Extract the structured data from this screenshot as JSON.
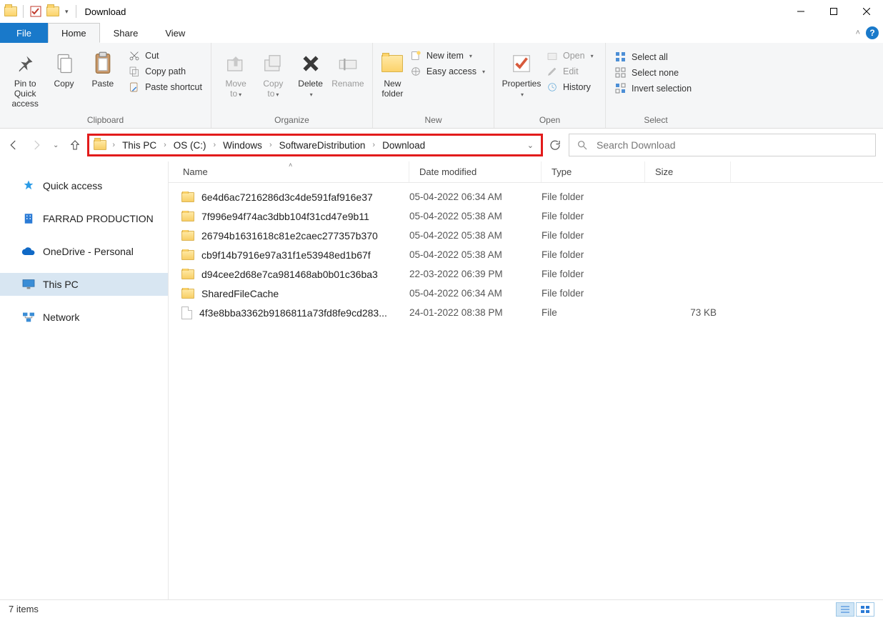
{
  "window": {
    "title": "Download"
  },
  "tabs": {
    "file": "File",
    "home": "Home",
    "share": "Share",
    "view": "View"
  },
  "ribbon": {
    "clipboard": {
      "label": "Clipboard",
      "pin": "Pin to Quick\naccess",
      "copy": "Copy",
      "paste": "Paste",
      "cut": "Cut",
      "copy_path": "Copy path",
      "paste_shortcut": "Paste shortcut"
    },
    "organize": {
      "label": "Organize",
      "move_to": "Move\nto",
      "copy_to": "Copy\nto",
      "delete": "Delete",
      "rename": "Rename"
    },
    "new": {
      "label": "New",
      "new_folder": "New\nfolder",
      "new_item": "New item",
      "easy_access": "Easy access"
    },
    "open": {
      "label": "Open",
      "properties": "Properties",
      "open": "Open",
      "edit": "Edit",
      "history": "History"
    },
    "select": {
      "label": "Select",
      "select_all": "Select all",
      "select_none": "Select none",
      "invert": "Invert selection"
    }
  },
  "breadcrumb": {
    "items": [
      "This PC",
      "OS (C:)",
      "Windows",
      "SoftwareDistribution",
      "Download"
    ]
  },
  "search": {
    "placeholder": "Search Download"
  },
  "sidebar": {
    "quick_access": "Quick access",
    "farrad": "FARRAD PRODUCTION",
    "onedrive": "OneDrive - Personal",
    "this_pc": "This PC",
    "network": "Network"
  },
  "columns": {
    "name": "Name",
    "date": "Date modified",
    "type": "Type",
    "size": "Size"
  },
  "rows": [
    {
      "icon": "folder",
      "name": "6e4d6ac7216286d3c4de591faf916e37",
      "date": "05-04-2022 06:34 AM",
      "type": "File folder",
      "size": ""
    },
    {
      "icon": "folder",
      "name": "7f996e94f74ac3dbb104f31cd47e9b11",
      "date": "05-04-2022 05:38 AM",
      "type": "File folder",
      "size": ""
    },
    {
      "icon": "folder",
      "name": "26794b1631618c81e2caec277357b370",
      "date": "05-04-2022 05:38 AM",
      "type": "File folder",
      "size": ""
    },
    {
      "icon": "folder",
      "name": "cb9f14b7916e97a31f1e53948ed1b67f",
      "date": "05-04-2022 05:38 AM",
      "type": "File folder",
      "size": ""
    },
    {
      "icon": "folder",
      "name": "d94cee2d68e7ca981468ab0b01c36ba3",
      "date": "22-03-2022 06:39 PM",
      "type": "File folder",
      "size": ""
    },
    {
      "icon": "folder",
      "name": "SharedFileCache",
      "date": "05-04-2022 06:34 AM",
      "type": "File folder",
      "size": ""
    },
    {
      "icon": "file",
      "name": "4f3e8bba3362b9186811a73fd8fe9cd283...",
      "date": "24-01-2022 08:38 PM",
      "type": "File",
      "size": "73 KB"
    }
  ],
  "status": {
    "text": "7 items"
  }
}
